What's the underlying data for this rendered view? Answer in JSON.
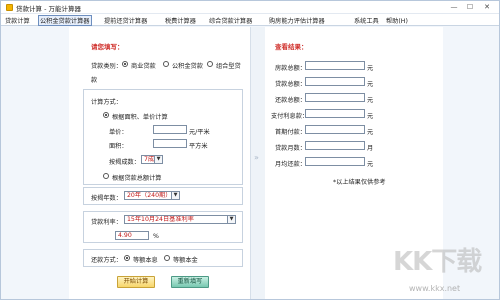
{
  "window": {
    "title": "贷款计算 - 万能计算器",
    "min_label": "—",
    "max_label": "☐",
    "close_label": "✕"
  },
  "menu": [
    {
      "label": "贷款计算"
    },
    {
      "label": "公积金贷款计算器"
    },
    {
      "label": "提前还贷计算器"
    },
    {
      "label": "税费计算器"
    },
    {
      "label": "综合贷款计算器"
    },
    {
      "label": "购房能力评估计算器"
    },
    {
      "label": "系统工具"
    },
    {
      "label": "帮助(H)"
    }
  ],
  "left": {
    "section_title": "请您填写：",
    "loan_type_label": "贷款类别：",
    "loan_types": [
      "商业贷款",
      "公积金贷款",
      "组合型贷",
      "款"
    ],
    "calc_method_label": "计算方式：",
    "method_area": "根据面积、单价计算",
    "unit_price_label": "单价：",
    "unit_price_value": "",
    "unit_price_unit": "元/平米",
    "area_label": "面积：",
    "area_value": "",
    "area_unit": "平方米",
    "ratio_label": "按揭成数：",
    "ratio_value": "7成",
    "method_total": "根据贷款总额计算",
    "years_label": "按揭年数：",
    "years_value": "20年（240期）",
    "rate_label": "贷款利率：",
    "rate_value": "15年10月24日基准利率",
    "rate_number": "4.90",
    "rate_unit": "%",
    "repay_label": "还款方式：",
    "repay_options": [
      "等额本息",
      "等额本金"
    ],
    "calc_button": "开始计算",
    "reset_button": "重新填写"
  },
  "right": {
    "section_title": "查看结果：",
    "rows": [
      {
        "label": "房款总额：",
        "unit": "元"
      },
      {
        "label": "贷款总额：",
        "unit": "元"
      },
      {
        "label": "还款总额：",
        "unit": "元"
      },
      {
        "label": "支付利息款：",
        "unit": "元"
      },
      {
        "label": "首期付款：",
        "unit": "元"
      },
      {
        "label": "贷款月数：",
        "unit": "月"
      },
      {
        "label": "月均还款：",
        "unit": "元"
      }
    ],
    "note": "*以上结果仅供参考"
  },
  "watermark": {
    "big": "KK下载",
    "url": "www.kkx.net"
  }
}
